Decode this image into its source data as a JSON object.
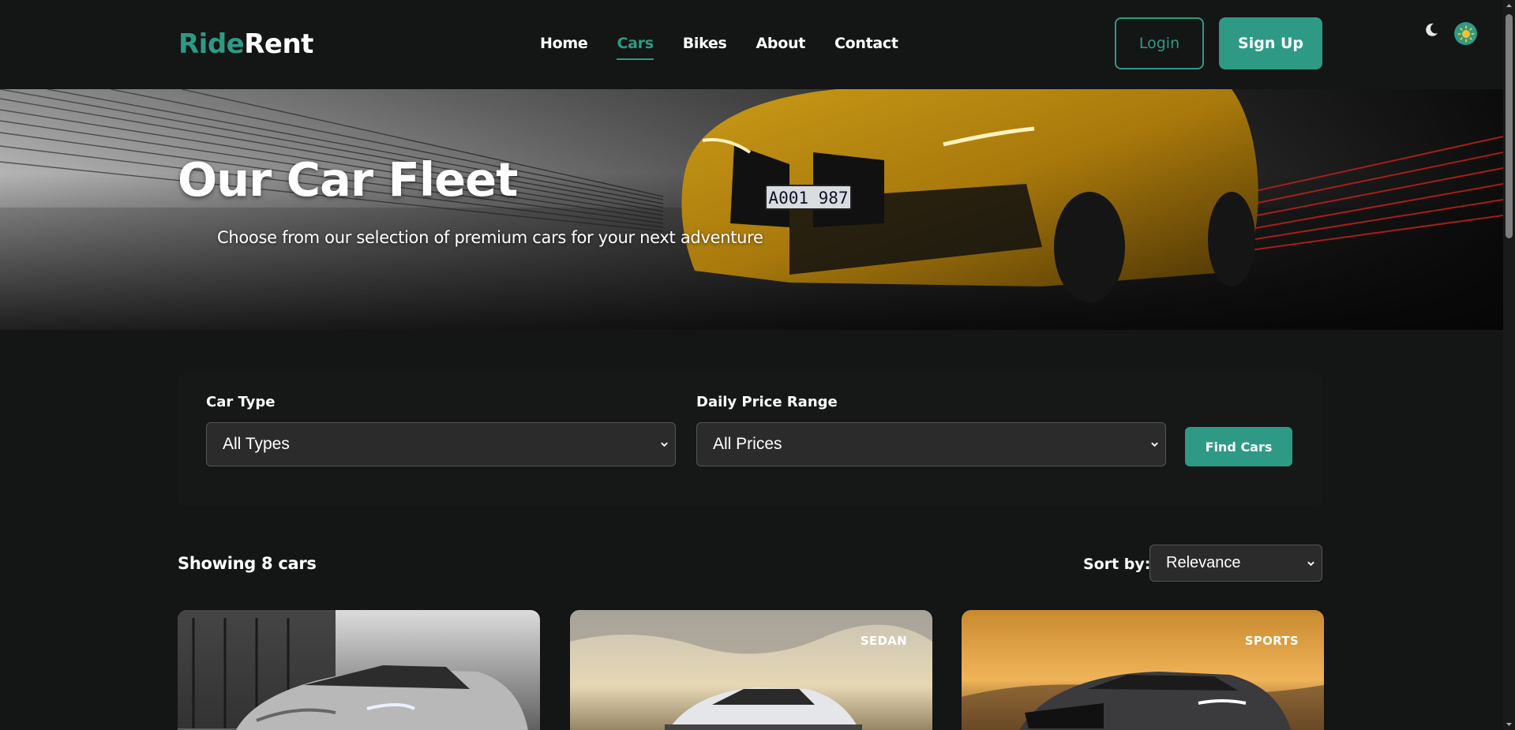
{
  "brand": {
    "part1": "Ride",
    "part2": "Rent"
  },
  "nav": {
    "items": [
      "Home",
      "Cars",
      "Bikes",
      "About",
      "Contact"
    ],
    "active": "Cars"
  },
  "auth": {
    "login": "Login",
    "signup": "Sign Up"
  },
  "theme": {
    "moon_icon": "moon-icon",
    "sun_icon": "sun-icon"
  },
  "hero": {
    "title": "Our Car Fleet",
    "subtitle": "Choose from our selection of premium cars for your next adventure",
    "plate": "A001 987"
  },
  "filters": {
    "car_type_label": "Car Type",
    "car_type_value": "All Types",
    "price_label": "Daily Price Range",
    "price_value": "All Prices",
    "find_button": "Find Cars"
  },
  "results": {
    "count_text": "Showing 8 cars",
    "sort_label": "Sort by:",
    "sort_value": "Relevance"
  },
  "cards": [
    {
      "badge": ""
    },
    {
      "badge": "SEDAN"
    },
    {
      "badge": "SPORTS"
    }
  ],
  "colors": {
    "accent": "#2e9a85",
    "background": "#141515",
    "panel": "#161717",
    "select_bg": "#2b2b2b"
  }
}
